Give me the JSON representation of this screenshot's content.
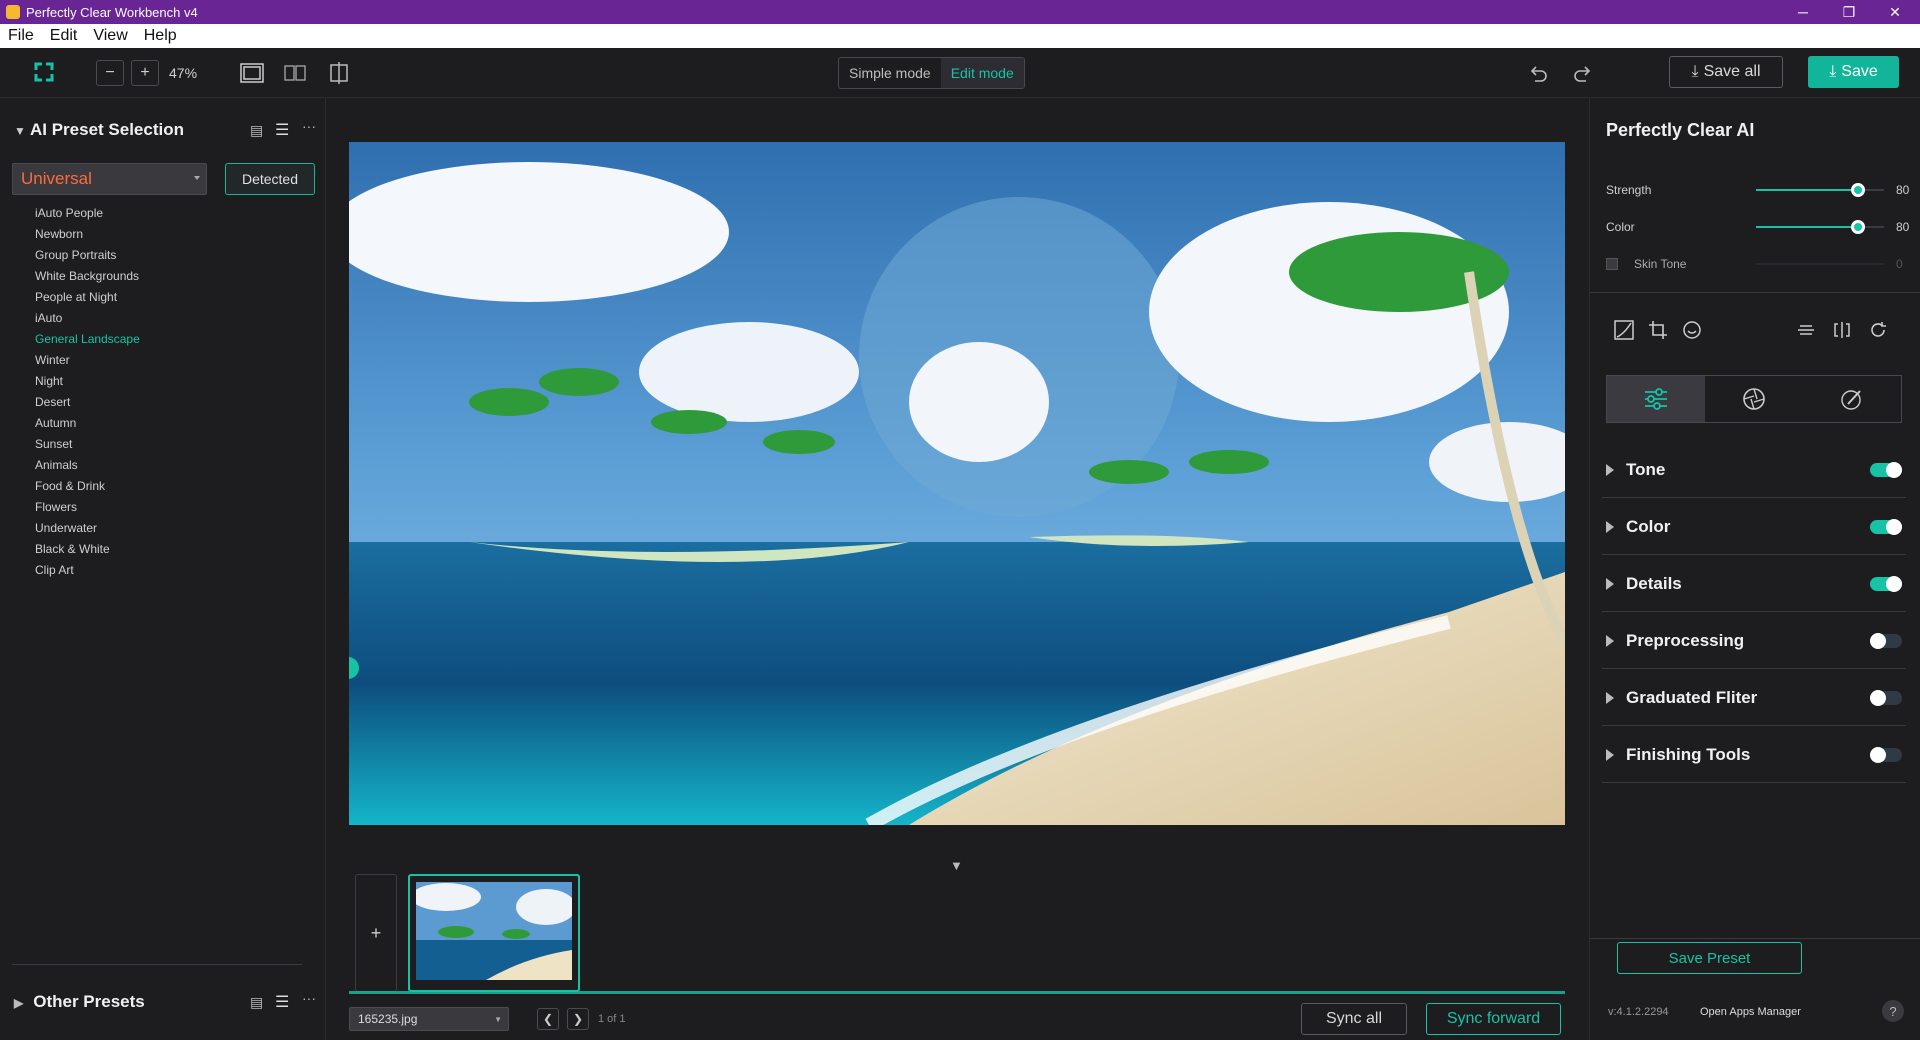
{
  "window": {
    "title": "Perfectly Clear Workbench v4"
  },
  "menu": [
    "File",
    "Edit",
    "View",
    "Help"
  ],
  "toolbar": {
    "zoom": "47%",
    "modes": [
      "Simple mode",
      "Edit mode"
    ],
    "active_mode": "Edit mode",
    "save_all": "Save all",
    "save": "Save"
  },
  "left": {
    "title": "AI Preset Selection",
    "dropdown_value": "Universal",
    "detected_label": "Detected",
    "presets": [
      "iAuto People",
      "Newborn",
      "Group Portraits",
      "White Backgrounds",
      "People at Night",
      "iAuto",
      "General Landscape",
      "Winter",
      "Night",
      "Desert",
      "Autumn",
      "Sunset",
      "Animals",
      "Food & Drink",
      "Flowers",
      "Underwater",
      "Black & White",
      "Clip Art"
    ],
    "active_preset": "General Landscape",
    "other_presets": "Other Presets"
  },
  "right": {
    "title": "Perfectly Clear AI",
    "strength_label": "Strength",
    "strength": 80,
    "color_label": "Color",
    "color": 80,
    "skin_label": "Skin Tone",
    "skin": 0,
    "sections": [
      {
        "label": "Tone",
        "on": true
      },
      {
        "label": "Color",
        "on": true
      },
      {
        "label": "Details",
        "on": true
      },
      {
        "label": "Preprocessing",
        "on": false
      },
      {
        "label": "Graduated Fliter",
        "on": false
      },
      {
        "label": "Finishing Tools",
        "on": false
      }
    ],
    "save_preset": "Save Preset",
    "version": "v:4.1.2.2294",
    "apps_manager": "Open Apps Manager",
    "help": "?"
  },
  "bottom": {
    "filename": "165235.jpg",
    "page": "1 of 1",
    "sync_all": "Sync all",
    "sync_forward": "Sync forward",
    "add": "+"
  },
  "colors": {
    "accent": "#16c3a5",
    "titlebar": "#6a2594",
    "preset_active": "#ff6a3d"
  }
}
